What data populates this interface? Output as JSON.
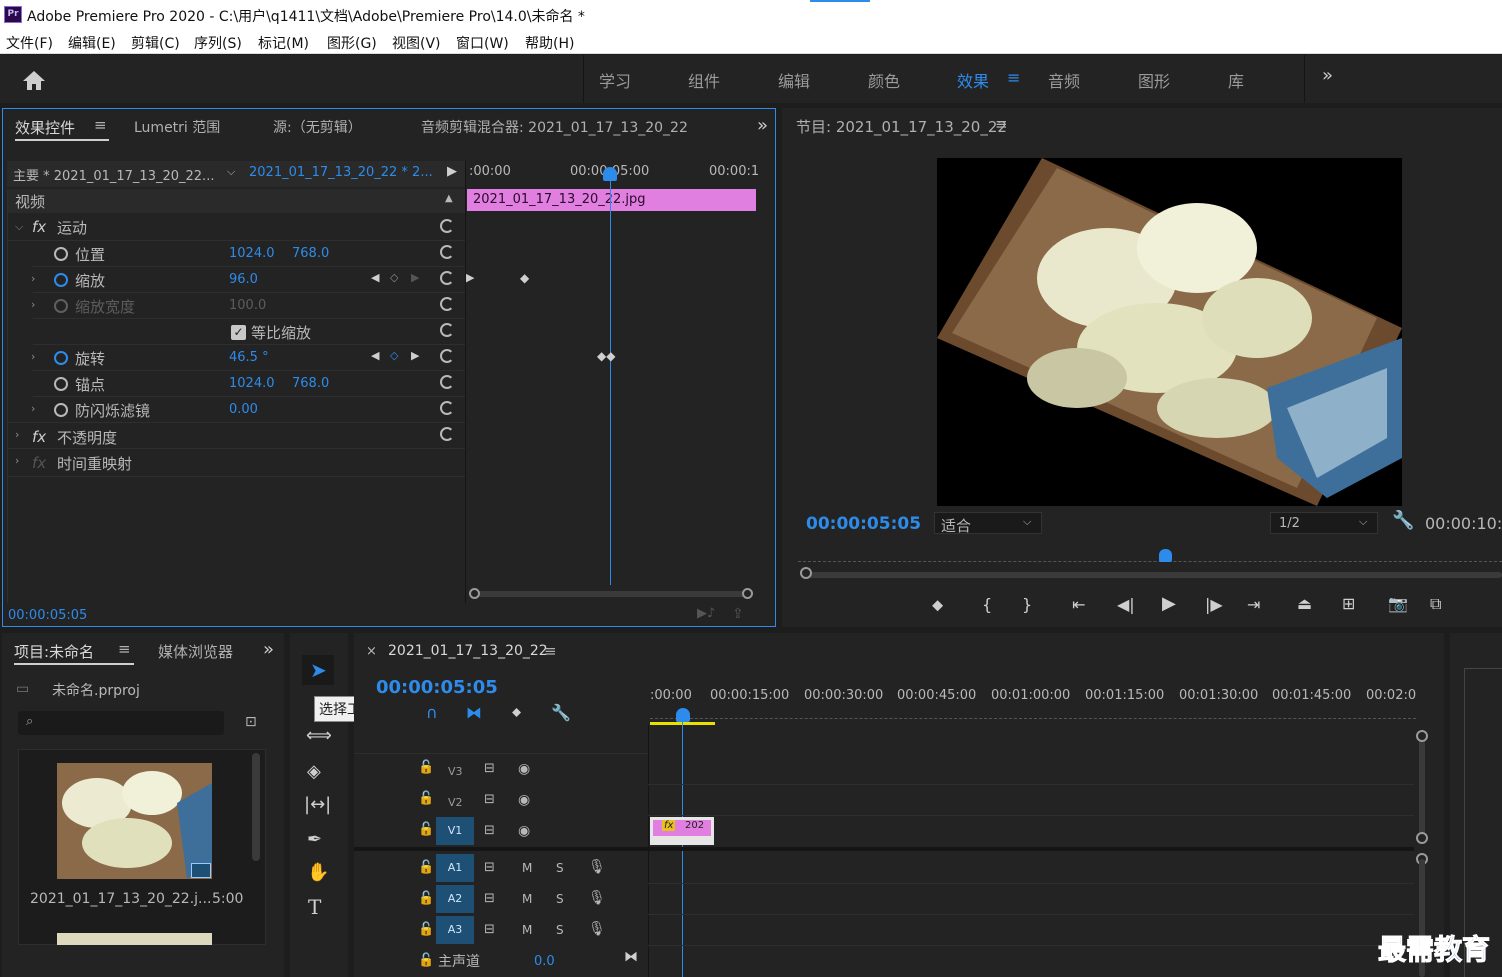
{
  "app": {
    "title": "Adobe Premiere Pro 2020 - C:\\用户\\q1411\\文档\\Adobe\\Premiere Pro\\14.0\\未命名 *",
    "icon": "Pr"
  },
  "menu": [
    "文件(F)",
    "编辑(E)",
    "剪辑(C)",
    "序列(S)",
    "标记(M)",
    "图形(G)",
    "视图(V)",
    "窗口(W)",
    "帮助(H)"
  ],
  "workspaces": [
    "学习",
    "组件",
    "编辑",
    "颜色",
    "效果",
    "音频",
    "图形",
    "库"
  ],
  "effect_controls": {
    "tabs": [
      "效果控件",
      "Lumetri 范围",
      "源:（无剪辑）",
      "音频剪辑混合器: 2021_01_17_13_20_22"
    ],
    "master": "主要 * 2021_01_17_13_20_22...",
    "sequence": "2021_01_17_13_20_22 * 2...",
    "ruler": [
      ":00:00",
      "00:00:05:00",
      "00:00:1"
    ],
    "clip_name": "2021_01_17_13_20_22.jpg",
    "section": "视频",
    "motion": "运动",
    "position": {
      "label": "位置",
      "x": "1024.0",
      "y": "768.0"
    },
    "scale": {
      "label": "缩放",
      "value": "96.0"
    },
    "scale_width": {
      "label": "缩放宽度",
      "value": "100.0"
    },
    "uniform": "等比缩放",
    "rotation": {
      "label": "旋转",
      "value": "46.5 °"
    },
    "anchor": {
      "label": "锚点",
      "x": "1024.0",
      "y": "768.0"
    },
    "antiflicker": {
      "label": "防闪烁滤镜",
      "value": "0.00"
    },
    "opacity": "不透明度",
    "time_remap": "时间重映射",
    "timecode": "00:00:05:05"
  },
  "program": {
    "title": "节目: 2021_01_17_13_20_22",
    "timecode": "00:00:05:05",
    "fit": "适合",
    "res": "1/2",
    "duration": "00:00:10:"
  },
  "project": {
    "tabs": [
      "项目:未命名",
      "媒体浏览器"
    ],
    "file": "未命名.prproj",
    "clip": "2021_01_17_13_20_22.j...",
    "clip_dur": "5:00"
  },
  "tools": {
    "tooltip": "选择工具 (V)"
  },
  "timeline": {
    "title": "2021_01_17_13_20_22",
    "timecode": "00:00:05:05",
    "ruler": [
      ":00:00",
      "00:00:15:00",
      "00:00:30:00",
      "00:00:45:00",
      "00:01:00:00",
      "00:01:15:00",
      "00:01:30:00",
      "00:01:45:00",
      "00:02:0"
    ],
    "video_tracks": [
      "V3",
      "V2",
      "V1"
    ],
    "audio_tracks": [
      "A1",
      "A2",
      "A3"
    ],
    "master": "主声道",
    "master_val": "0.0",
    "clip_label": "202",
    "m": "M",
    "s": "S"
  },
  "watermark": "最需教育",
  "colors": {
    "accent": "#2d8ceb",
    "clip": "#e07fe0",
    "playhead": "#2d8ceb"
  }
}
